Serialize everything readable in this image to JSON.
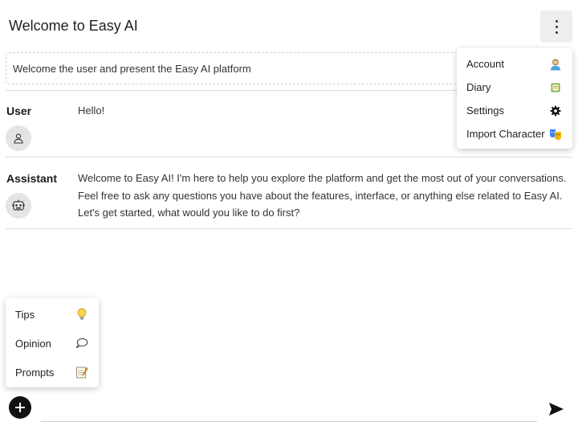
{
  "app": {
    "title": "Welcome to Easy AI"
  },
  "system_prompt": {
    "text": "Welcome the user and present the Easy AI platform"
  },
  "messages": [
    {
      "role": "User",
      "avatar_icon": "person-icon",
      "text": "Hello!"
    },
    {
      "role": "Assistant",
      "avatar_icon": "robot-icon",
      "text": "Welcome to Easy AI! I'm here to help you explore the platform and get the most out of your conversations. Feel free to ask any questions you have about the features, interface, or anything else related to Easy AI. Let's get started, what would you like to do first?"
    }
  ],
  "top_menu": {
    "items": [
      {
        "label": "Account",
        "icon": "user-emoji-icon"
      },
      {
        "label": "Diary",
        "icon": "notebook-icon"
      },
      {
        "label": "Settings",
        "icon": "gear-icon"
      },
      {
        "label": "Import Character",
        "icon": "masks-icon"
      }
    ]
  },
  "bottom_menu": {
    "items": [
      {
        "label": "Tips",
        "icon": "lightbulb-icon"
      },
      {
        "label": "Opinion",
        "icon": "speech-bubble-icon"
      },
      {
        "label": "Prompts",
        "icon": "memo-icon"
      }
    ]
  },
  "input": {
    "value": "",
    "placeholder": ""
  },
  "colors": {
    "accent": "#111111",
    "background": "#ffffff",
    "kebab_bg": "#eeeeee"
  }
}
